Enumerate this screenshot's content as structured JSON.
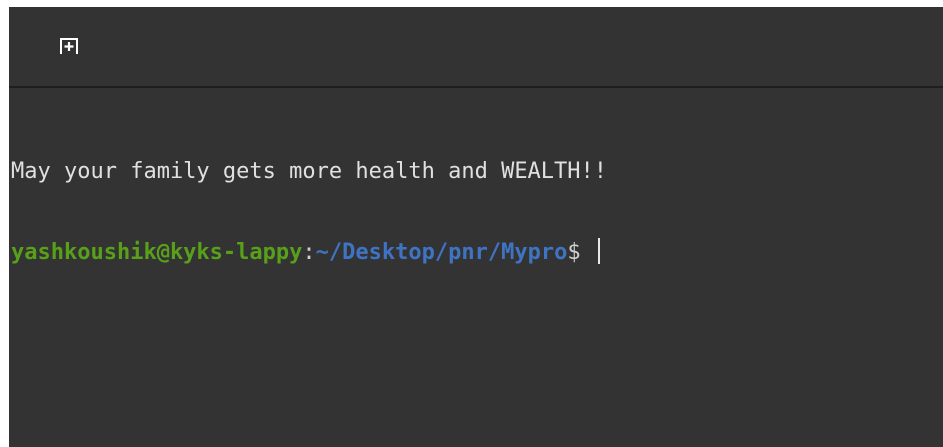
{
  "toolbar": {
    "new_tab_icon": "new-tab-plus-icon"
  },
  "terminal": {
    "output_line": "May your family gets more health and WEALTH!!",
    "prompt": {
      "user_host": "yashkoushik@kyks-lappy",
      "separator": ":",
      "path": "~/Desktop/pnr/Mypro",
      "symbol": "$ "
    }
  },
  "colors": {
    "background": "#333333",
    "text": "#e0e0e0",
    "user_host": "#58a01a",
    "path": "#3f74c4"
  }
}
